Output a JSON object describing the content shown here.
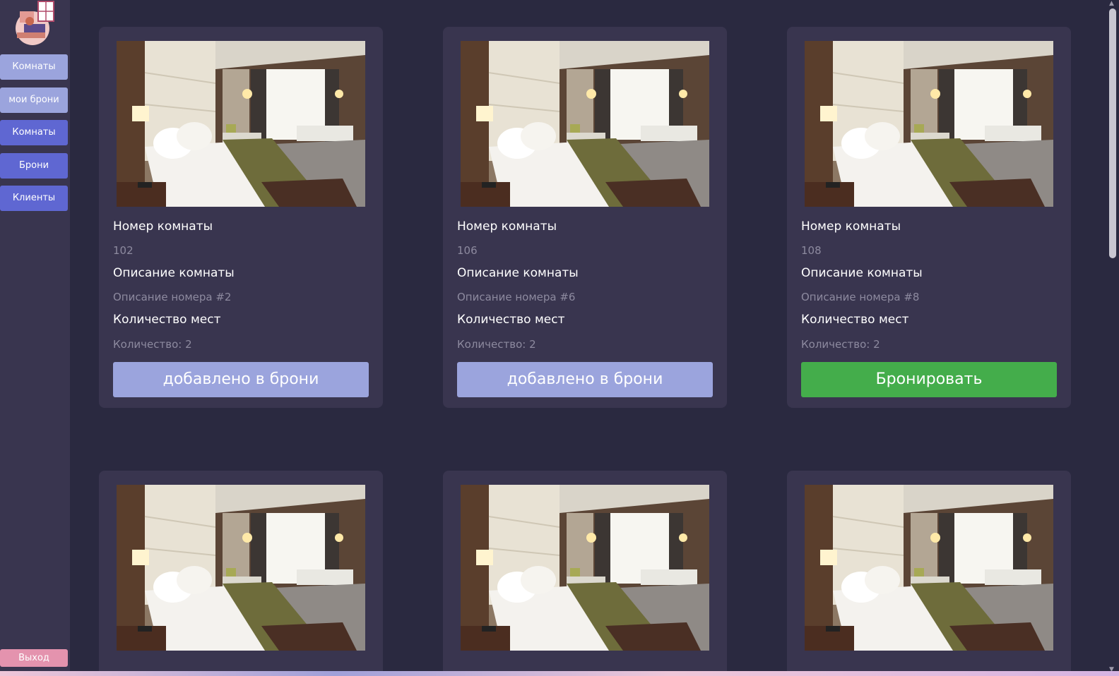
{
  "sidebar": {
    "logo_icon": "hotel-logo-icon",
    "items": [
      {
        "label": "Комнаты",
        "style": "light"
      },
      {
        "label": "мои брони",
        "style": "light"
      },
      {
        "label": "Комнаты",
        "style": "blue"
      },
      {
        "label": "Брони",
        "style": "blue"
      },
      {
        "label": "Клиенты",
        "style": "blue"
      }
    ],
    "exit_label": "Выход"
  },
  "cards": [
    {
      "number_label": "Номер комнаты",
      "number": "102",
      "description_label": "Описание комнаты",
      "description": "Описание номера #2",
      "seats_label": "Количество мест",
      "seats": "Количество: 2",
      "button_label": "добавлено в брони",
      "button_state": "added"
    },
    {
      "number_label": "Номер комнаты",
      "number": "106",
      "description_label": "Описание комнаты",
      "description": "Описание номера #6",
      "seats_label": "Количество мест",
      "seats": "Количество: 2",
      "button_label": "добавлено в брони",
      "button_state": "added"
    },
    {
      "number_label": "Номер комнаты",
      "number": "108",
      "description_label": "Описание комнаты",
      "description": "Описание номера #8",
      "seats_label": "Количество мест",
      "seats": "Количество: 2",
      "button_label": "Бронировать",
      "button_state": "book"
    }
  ],
  "colors": {
    "background": "#2a2940",
    "card": "#39354f",
    "added_button": "#9ba4dd",
    "book_button": "#44ad4b",
    "nav_blue": "#5f67d2",
    "exit": "#e493ae"
  }
}
